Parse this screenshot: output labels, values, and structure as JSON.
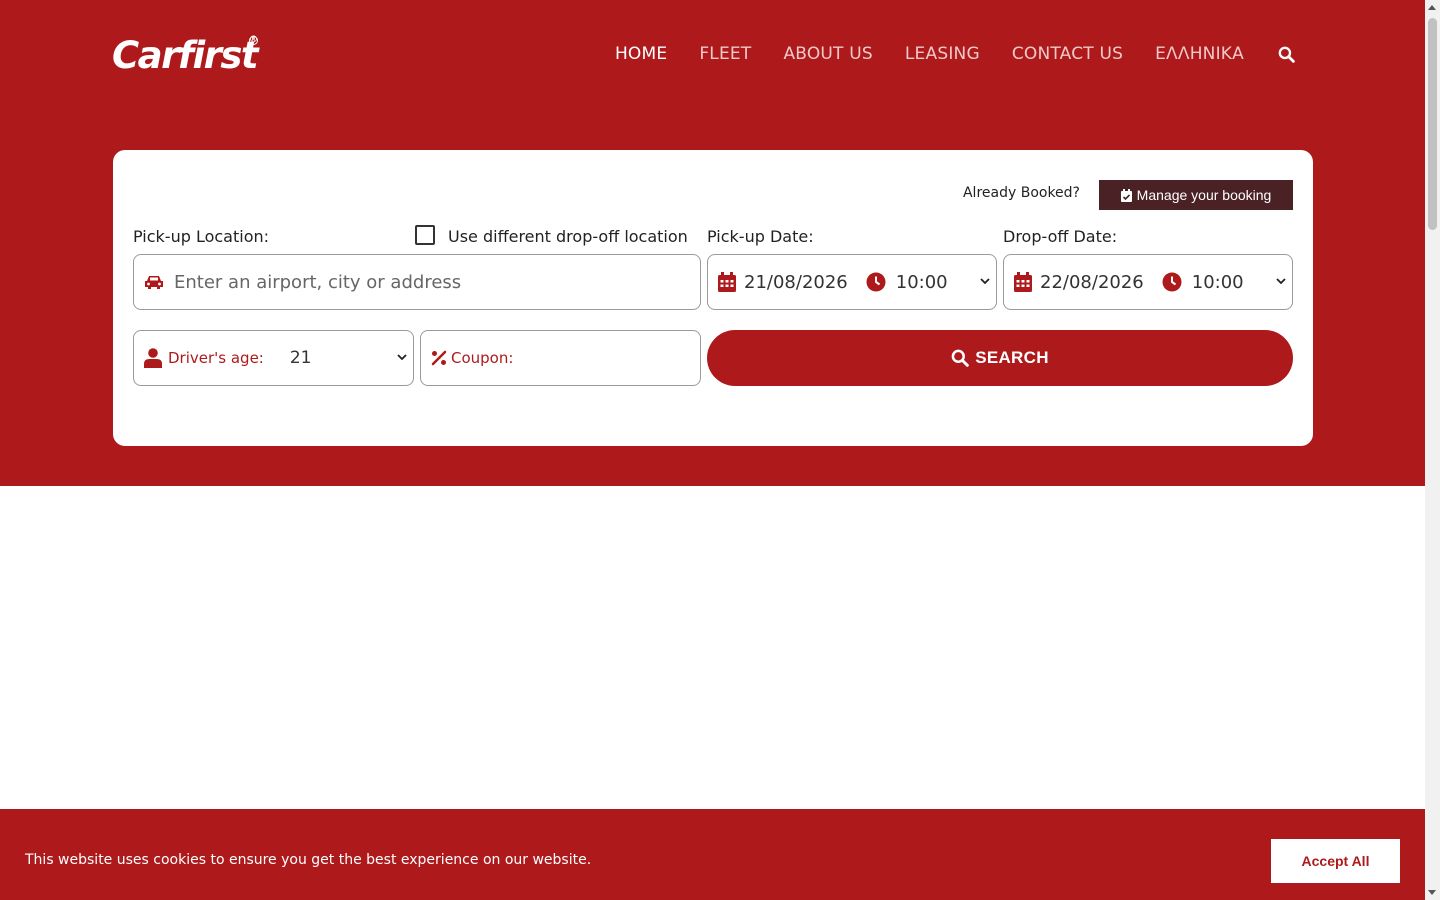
{
  "brand": {
    "name": "Carfirst",
    "registered": "®",
    "accent_color": "#ae1a1c",
    "dark_button_color": "#4a2125"
  },
  "nav": {
    "items": [
      {
        "label": "HOME",
        "active": true
      },
      {
        "label": "FLEET"
      },
      {
        "label": "ABOUT US"
      },
      {
        "label": "LEASING"
      },
      {
        "label": "CONTACT US"
      },
      {
        "label": "ΕΛΛΗΝΙΚΑ"
      }
    ],
    "search_icon": "search-icon"
  },
  "booking": {
    "already_booked": "Already Booked?",
    "manage_label": "Manage your booking",
    "pickup_location_label": "Pick-up Location:",
    "different_dropoff_label": "Use different drop-off location",
    "pickup_date_label": "Pick-up Date:",
    "dropoff_date_label": "Drop-off Date:",
    "location_placeholder": "Enter an airport, city or address",
    "pickup_date": "21/08/2026",
    "pickup_time": "10:00",
    "dropoff_date": "22/08/2026",
    "dropoff_time": "10:00",
    "driver_age_label": "Driver's age:",
    "driver_age": "21",
    "coupon_label": "Coupon:",
    "search_label": "SEARCH"
  },
  "cookie": {
    "text": "This website uses cookies to ensure you get the best experience on our website.",
    "accept_label": "Accept All"
  }
}
